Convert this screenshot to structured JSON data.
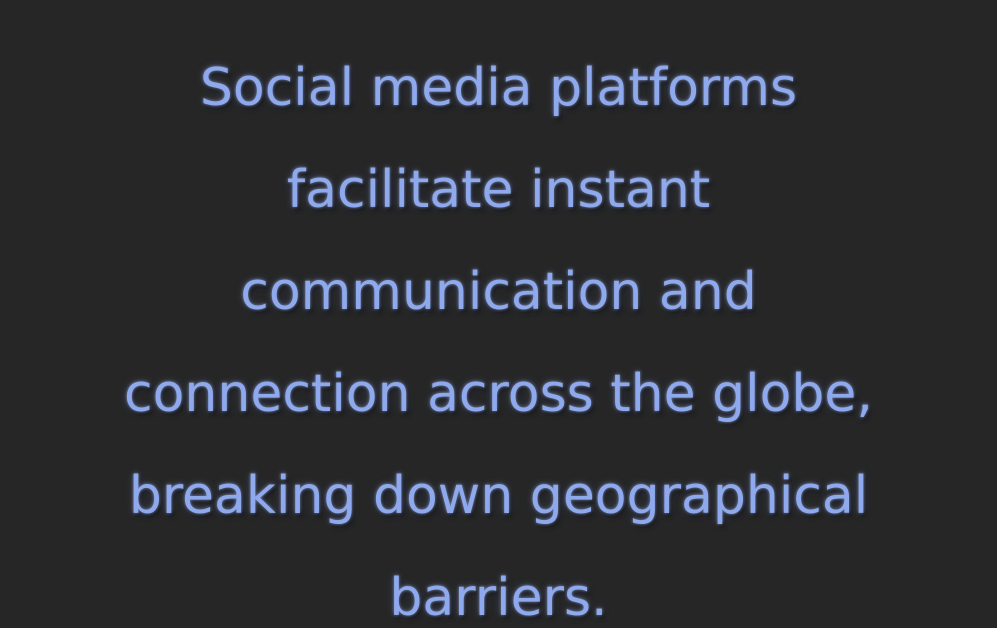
{
  "text": {
    "lines": [
      "Social media platforms",
      "facilitate instant",
      "communication and",
      "connection across the globe,",
      "breaking down geographical",
      "barriers."
    ]
  },
  "colors": {
    "background": "#262626",
    "text": "#8ea9ee"
  }
}
